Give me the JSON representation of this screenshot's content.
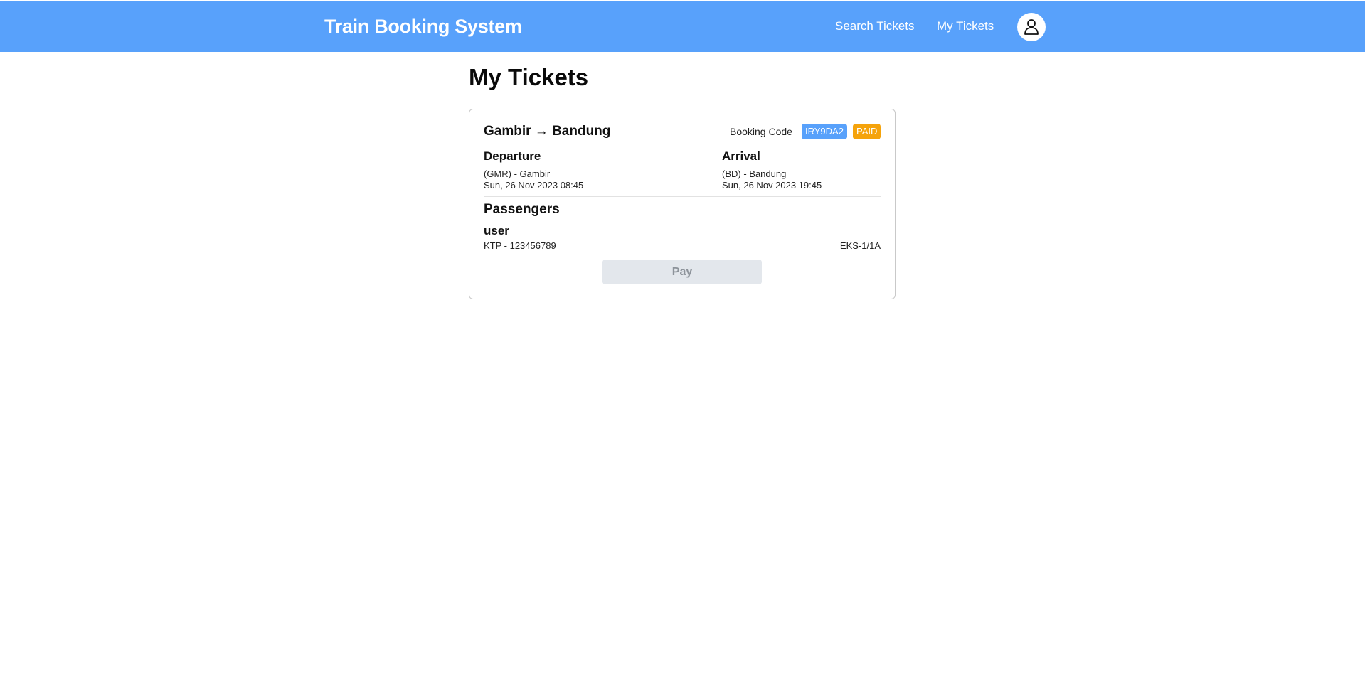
{
  "header": {
    "brand": "Train Booking System",
    "nav": {
      "search_tickets": "Search Tickets",
      "my_tickets": "My Tickets"
    },
    "avatar_icon": "user-icon"
  },
  "page": {
    "title": "My Tickets"
  },
  "ticket": {
    "route": "Gambir → Bandung",
    "booking_code_label": "Booking Code",
    "booking_code": "IRY9DA2",
    "status": "PAID",
    "departure": {
      "label": "Departure",
      "station": "(GMR) - Gambir",
      "time": "Sun, 26 Nov 2023 08:45"
    },
    "arrival": {
      "label": "Arrival",
      "station": "(BD) - Bandung",
      "time": "Sun, 26 Nov 2023 19:45"
    },
    "passengers_label": "Passengers",
    "passengers": [
      {
        "name": "user",
        "id": "KTP - 123456789",
        "seat": "EKS-1/1A"
      }
    ],
    "pay_label": "Pay"
  },
  "colors": {
    "header_bg": "#58a1fb",
    "code_badge": "#58a1fb",
    "paid_badge": "#f5a30b",
    "pay_disabled_bg": "#e3e7ec"
  }
}
